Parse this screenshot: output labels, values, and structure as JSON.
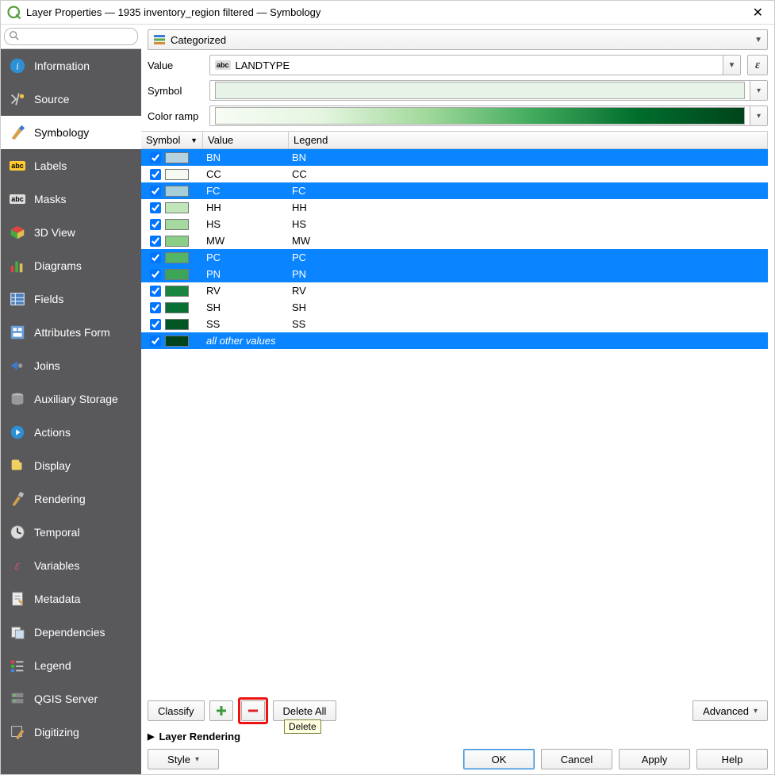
{
  "window": {
    "title": "Layer Properties — 1935 inventory_region filtered — Symbology",
    "close_glyph": "✕"
  },
  "search": {
    "placeholder": ""
  },
  "nav": [
    {
      "id": "information",
      "label": "Information"
    },
    {
      "id": "source",
      "label": "Source"
    },
    {
      "id": "symbology",
      "label": "Symbology"
    },
    {
      "id": "labels",
      "label": "Labels"
    },
    {
      "id": "masks",
      "label": "Masks"
    },
    {
      "id": "3dview",
      "label": "3D View"
    },
    {
      "id": "diagrams",
      "label": "Diagrams"
    },
    {
      "id": "fields",
      "label": "Fields"
    },
    {
      "id": "attributesform",
      "label": "Attributes Form"
    },
    {
      "id": "joins",
      "label": "Joins"
    },
    {
      "id": "auxiliary",
      "label": "Auxiliary Storage"
    },
    {
      "id": "actions",
      "label": "Actions"
    },
    {
      "id": "display",
      "label": "Display"
    },
    {
      "id": "rendering",
      "label": "Rendering"
    },
    {
      "id": "temporal",
      "label": "Temporal"
    },
    {
      "id": "variables",
      "label": "Variables"
    },
    {
      "id": "metadata",
      "label": "Metadata"
    },
    {
      "id": "dependencies",
      "label": "Dependencies"
    },
    {
      "id": "legend",
      "label": "Legend"
    },
    {
      "id": "qgisserver",
      "label": "QGIS Server"
    },
    {
      "id": "digitizing",
      "label": "Digitizing"
    }
  ],
  "symbology": {
    "type_label": "Categorized",
    "value_label": "Value",
    "value_field_prefix": "abc",
    "value_field": "LANDTYPE",
    "symbol_label": "Symbol",
    "colorramp_label": "Color ramp"
  },
  "grid": {
    "headers": {
      "symbol": "Symbol",
      "value": "Value",
      "legend": "Legend"
    },
    "rows": [
      {
        "checked": true,
        "color": "#b6d2de",
        "value": "BN",
        "legend": "BN",
        "selected": true
      },
      {
        "checked": true,
        "color": "#f4faf2",
        "value": "CC",
        "legend": "CC",
        "selected": false
      },
      {
        "checked": true,
        "color": "#a4cfd8",
        "value": "FC",
        "legend": "FC",
        "selected": true
      },
      {
        "checked": true,
        "color": "#c0e6b9",
        "value": "HH",
        "legend": "HH",
        "selected": false
      },
      {
        "checked": true,
        "color": "#a5d99f",
        "value": "HS",
        "legend": "HS",
        "selected": false
      },
      {
        "checked": true,
        "color": "#8ace88",
        "value": "MW",
        "legend": "MW",
        "selected": false
      },
      {
        "checked": true,
        "color": "#54b567",
        "value": "PC",
        "legend": "PC",
        "selected": true
      },
      {
        "checked": true,
        "color": "#3ca558",
        "value": "PN",
        "legend": "PN",
        "selected": true
      },
      {
        "checked": true,
        "color": "#1a8540",
        "value": "RV",
        "legend": "RV",
        "selected": false
      },
      {
        "checked": true,
        "color": "#087032",
        "value": "SH",
        "legend": "SH",
        "selected": false
      },
      {
        "checked": true,
        "color": "#005723",
        "value": "SS",
        "legend": "SS",
        "selected": false
      },
      {
        "checked": true,
        "color": "#00441b",
        "value": "all other values",
        "legend": "",
        "selected": true,
        "allother": true
      }
    ]
  },
  "buttons": {
    "classify": "Classify",
    "delete_all": "Delete All",
    "advanced": "Advanced",
    "tooltip_delete": "Delete",
    "layer_rendering": "Layer Rendering",
    "style": "Style",
    "ok": "OK",
    "cancel": "Cancel",
    "apply": "Apply",
    "help": "Help",
    "epsilon": "ε"
  }
}
